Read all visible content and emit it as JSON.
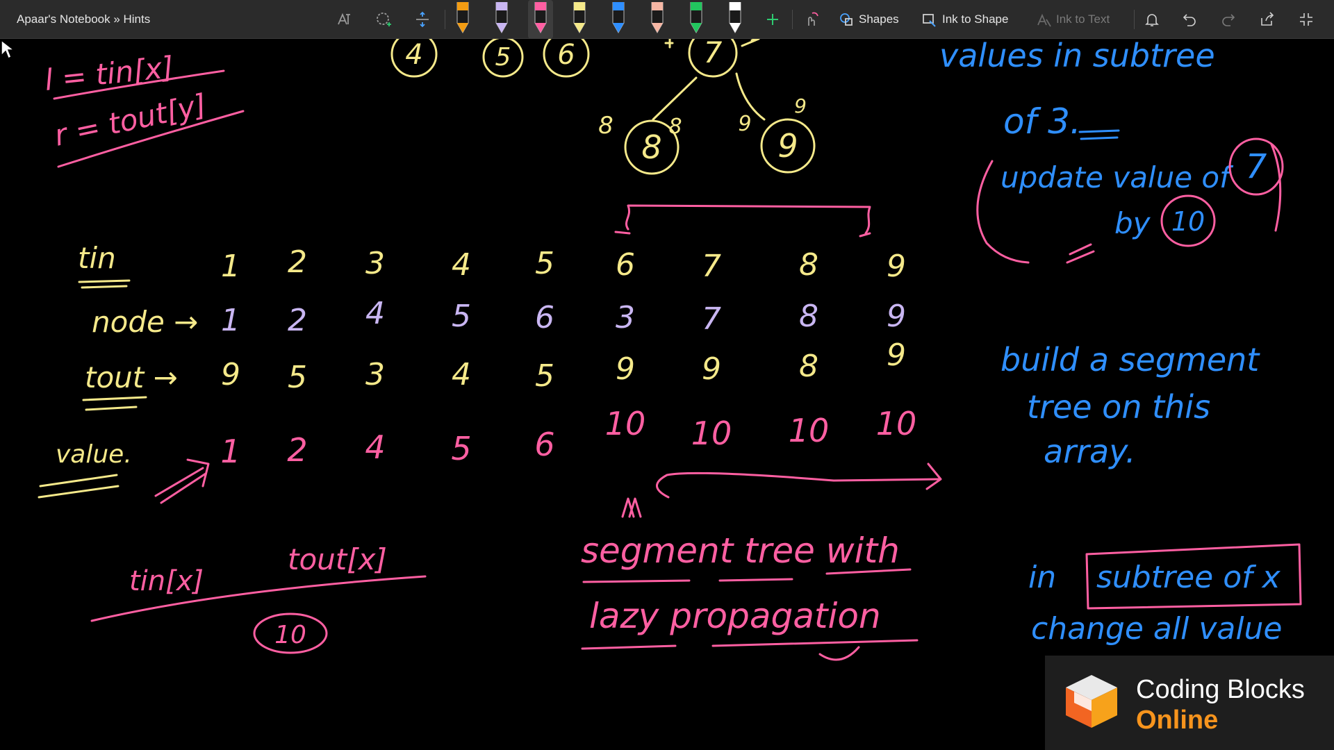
{
  "window": {
    "breadcrumb": "Apaar's Notebook » Hints"
  },
  "toolbar": {
    "lasso_icon": "lasso-select-icon",
    "add_space_icon": "insert-space-icon",
    "pens": [
      {
        "name": "pen-orange",
        "color": "#f39c12"
      },
      {
        "name": "pen-lavender",
        "color": "#c9b6f2"
      },
      {
        "name": "pen-pink",
        "color": "#ff5fa2"
      },
      {
        "name": "pen-yellow",
        "color": "#f5e98a"
      },
      {
        "name": "pen-blue",
        "color": "#2f8fff"
      },
      {
        "name": "pen-peach",
        "color": "#f6b7a5"
      },
      {
        "name": "pen-green",
        "color": "#22c55e"
      },
      {
        "name": "pen-white",
        "color": "#ffffff"
      }
    ],
    "shapes_label": "Shapes",
    "ink_to_shape_label": "Ink to Shape",
    "ink_to_text_label": "Ink to Text",
    "accent": "#4aa3ff"
  },
  "canvas": {
    "tree": {
      "nodes": [
        "4",
        "5",
        "6",
        "7",
        "8",
        "9"
      ],
      "edge_labels": [
        "8",
        "8",
        "9",
        "9"
      ]
    },
    "left_defs": {
      "line1": "l = tin[x]",
      "line2": "r = tout[y]"
    },
    "table": {
      "tin": {
        "label": "tin",
        "values": [
          "1",
          "2",
          "3",
          "4",
          "5",
          "6",
          "7",
          "8",
          "9"
        ]
      },
      "node": {
        "label": "node →",
        "values": [
          "1",
          "2",
          "4",
          "5",
          "6",
          "3",
          "7",
          "8",
          "9"
        ]
      },
      "tout": {
        "label": "tout →",
        "values": [
          "9",
          "5",
          "3",
          "4",
          "5",
          "9",
          "9",
          "8",
          "9"
        ]
      },
      "value": {
        "label": "value.",
        "values": [
          "1",
          "2",
          "4",
          "5",
          "6",
          "10",
          "10",
          "10",
          "10"
        ]
      }
    },
    "fraction": {
      "numerator_left": "tin[x]",
      "numerator_right": "tout[x]",
      "denominator": "10"
    },
    "segment_tree_note": {
      "line1": "segment tree with",
      "line2": "lazy propagation"
    },
    "right_notes": {
      "values_in_subtree": "values in subtree",
      "of_3": "of 3.",
      "update_line1": "update value of",
      "update_node": "7",
      "update_line2": "by",
      "update_value": "10",
      "build_line1": "build a segment",
      "build_line2": "tree on this",
      "build_line3": "array.",
      "in_label": "in",
      "subtree_box": "subtree of x",
      "change_label": "change all value"
    },
    "ink_colors": {
      "pink": "#ff5fa2",
      "yellow": "#f5e98a",
      "lavender": "#c9b6f2",
      "blue": "#2f8fff"
    }
  },
  "badge": {
    "line1": "Coding Blocks",
    "line2": "Online"
  }
}
